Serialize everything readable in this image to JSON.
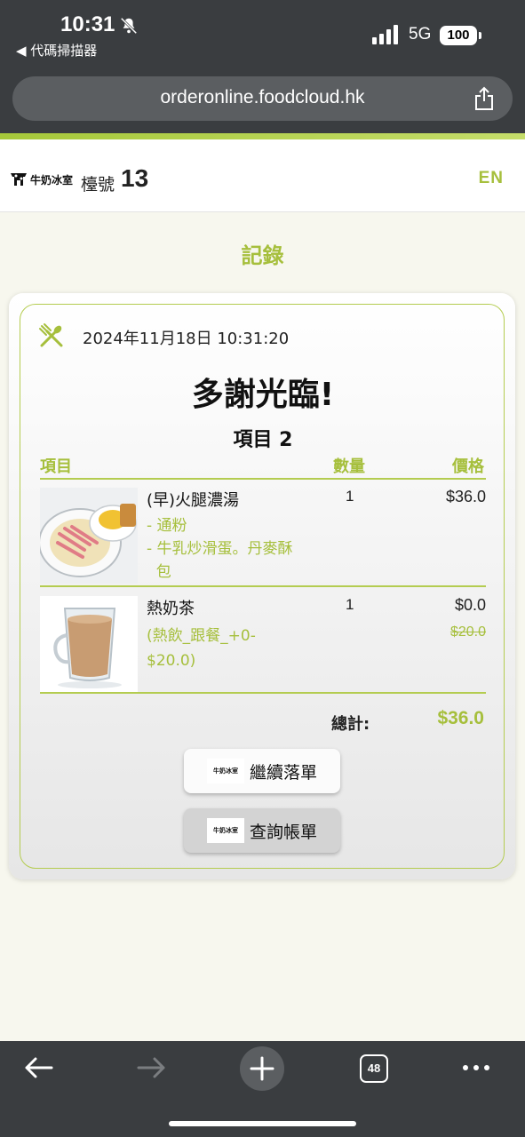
{
  "status_bar": {
    "time": "10:31",
    "back_app": "◀ 代碼掃描器",
    "network": "5G",
    "battery": "100"
  },
  "browser": {
    "url": "orderonline.foodcloud.hk"
  },
  "header": {
    "logo_text": "牛奶冰室",
    "table_label": "檯號",
    "table_number": "13",
    "language": "EN"
  },
  "page": {
    "title": "記錄"
  },
  "receipt": {
    "datetime": "2024年11月18日 10:31:20",
    "thanks": "多謝光臨!",
    "item_count": "項目 2",
    "headers": {
      "item": "項目",
      "qty": "數量",
      "price": "價格"
    },
    "items": [
      {
        "name": "(早)火腿濃湯",
        "options": [
          "- 通粉",
          "- 牛乳炒滑蛋。丹麥酥",
          "  包"
        ],
        "qty": "1",
        "price": "$36.0",
        "original_price": ""
      },
      {
        "name": "熱奶茶",
        "options": [
          "(熱飲_跟餐_+0-",
          "$20.0)"
        ],
        "qty": "1",
        "price": "$0.0",
        "original_price": "$20.0"
      }
    ],
    "total_label": "總計:",
    "total_value": "$36.0"
  },
  "buttons": {
    "continue_label": "繼續落單",
    "bill_label": "查詢帳單",
    "logo_text": "牛奶冰室"
  },
  "toolbar": {
    "tab_count": "48"
  },
  "colors": {
    "accent": "#a6bf3c",
    "chrome": "#3a3d40",
    "background": "#f7f7ee"
  }
}
